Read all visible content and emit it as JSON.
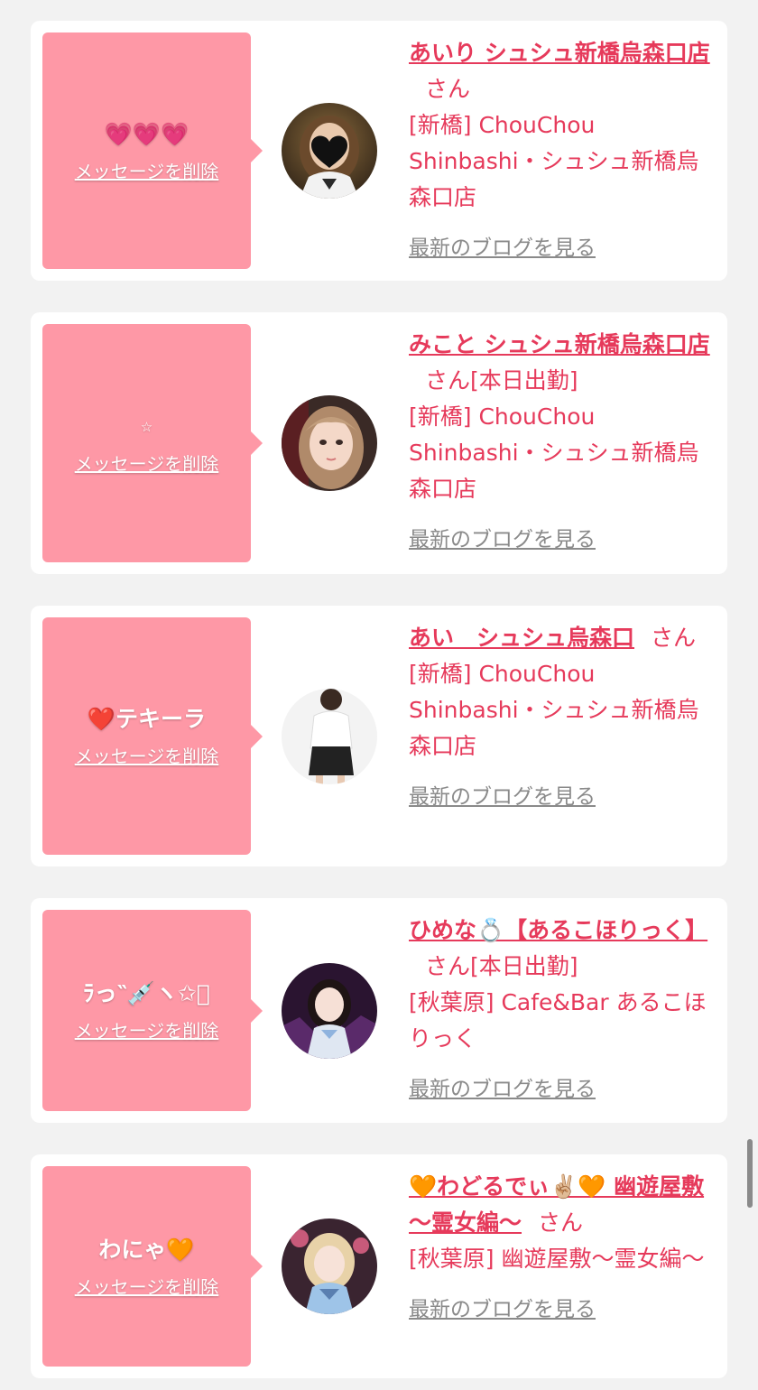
{
  "colors": {
    "page_background": "#f2f2f2",
    "card_background": "#ffffff",
    "message_box": "#fe98a6",
    "accent_pink": "#e63a5b",
    "muted_link": "#8a8a8a"
  },
  "items": [
    {
      "message": "💗💗💗",
      "delete_label": "メッセージを削除",
      "name": "あいり シュシュ新橋烏森口店",
      "suffix": "さん",
      "attendance": "",
      "shop": "[新橋] ChouChou Shinbashi・シュシュ新橋烏森口店",
      "blog_label": "最新のブログを見る",
      "avatar_icon": "woman-photo-heart-mask-icon"
    },
    {
      "message": "☆",
      "delete_label": "メッセージを削除",
      "name": "みこと シュシュ新橋烏森口店",
      "suffix": "さん",
      "attendance": "[本日出勤]",
      "shop": "[新橋] ChouChou Shinbashi・シュシュ新橋烏森口店",
      "blog_label": "最新のブログを見る",
      "avatar_icon": "woman-portrait-photo-icon"
    },
    {
      "message": "❤️テキーラ",
      "delete_label": "メッセージを削除",
      "name": "あい　シュシュ烏森口",
      "suffix": "さん",
      "attendance": "",
      "shop": "[新橋] ChouChou Shinbashi・シュシュ新橋烏森口店",
      "blog_label": "最新のブログを見る",
      "avatar_icon": "woman-full-body-photo-icon"
    },
    {
      "message": "ﾗっ‶💉ヽ✩ﾟ",
      "delete_label": "メッセージを削除",
      "name": "ひめな💍【あるこほりっく】",
      "suffix": "さん",
      "attendance": "[本日出勤]",
      "shop": "[秋葉原] Cafe&Bar あるこほりっく",
      "blog_label": "最新のブログを見る",
      "avatar_icon": "woman-idol-photo-icon"
    },
    {
      "message": "わにゃ🧡",
      "delete_label": "メッセージを削除",
      "name": "🧡わどるでぃ✌🏼🧡 幽遊屋敷～霊女編～",
      "suffix": "さん",
      "attendance": "",
      "shop": "[秋葉原] 幽遊屋敷～霊女編～",
      "blog_label": "最新のブログを見る",
      "avatar_icon": "woman-cosplay-photo-icon"
    }
  ]
}
